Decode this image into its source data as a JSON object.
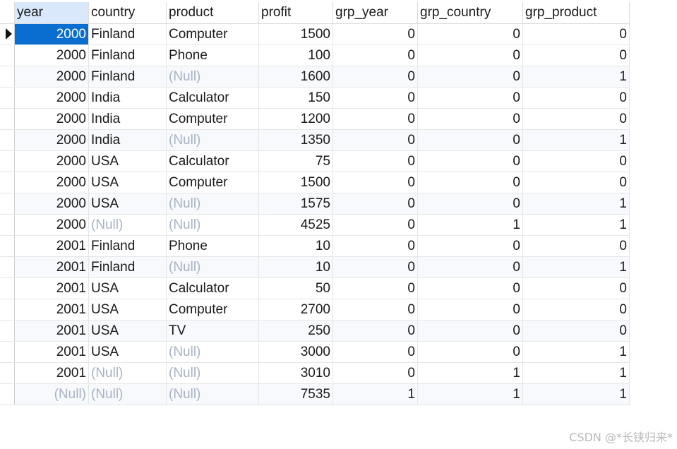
{
  "columns": [
    "year",
    "country",
    "product",
    "profit",
    "grp_year",
    "grp_country",
    "grp_product"
  ],
  "rows": [
    [
      "2000",
      "Finland",
      "Computer",
      "1500",
      "0",
      "0",
      "0"
    ],
    [
      "2000",
      "Finland",
      "Phone",
      "100",
      "0",
      "0",
      "0"
    ],
    [
      "2000",
      "Finland",
      "(Null)",
      "1600",
      "0",
      "0",
      "1"
    ],
    [
      "2000",
      "India",
      "Calculator",
      "150",
      "0",
      "0",
      "0"
    ],
    [
      "2000",
      "India",
      "Computer",
      "1200",
      "0",
      "0",
      "0"
    ],
    [
      "2000",
      "India",
      "(Null)",
      "1350",
      "0",
      "0",
      "1"
    ],
    [
      "2000",
      "USA",
      "Calculator",
      "75",
      "0",
      "0",
      "0"
    ],
    [
      "2000",
      "USA",
      "Computer",
      "1500",
      "0",
      "0",
      "0"
    ],
    [
      "2000",
      "USA",
      "(Null)",
      "1575",
      "0",
      "0",
      "1"
    ],
    [
      "2000",
      "(Null)",
      "(Null)",
      "4525",
      "0",
      "1",
      "1"
    ],
    [
      "2001",
      "Finland",
      "Phone",
      "10",
      "0",
      "0",
      "0"
    ],
    [
      "2001",
      "Finland",
      "(Null)",
      "10",
      "0",
      "0",
      "1"
    ],
    [
      "2001",
      "USA",
      "Calculator",
      "50",
      "0",
      "0",
      "0"
    ],
    [
      "2001",
      "USA",
      "Computer",
      "2700",
      "0",
      "0",
      "0"
    ],
    [
      "2001",
      "USA",
      "TV",
      "250",
      "0",
      "0",
      "0"
    ],
    [
      "2001",
      "USA",
      "(Null)",
      "3000",
      "0",
      "0",
      "1"
    ],
    [
      "2001",
      "(Null)",
      "(Null)",
      "3010",
      "0",
      "1",
      "1"
    ],
    [
      "(Null)",
      "(Null)",
      "(Null)",
      "7535",
      "1",
      "1",
      "1"
    ]
  ],
  "null_label": "(Null)",
  "current_row_indicator": "play-arrow-icon",
  "watermark": "CSDN @*长铗归来*",
  "colors": {
    "selection": "#0a6ed1",
    "header_selected": "#d9e8fb",
    "null_text": "#a8b3c3",
    "alt_row": "#f7f9fc"
  }
}
